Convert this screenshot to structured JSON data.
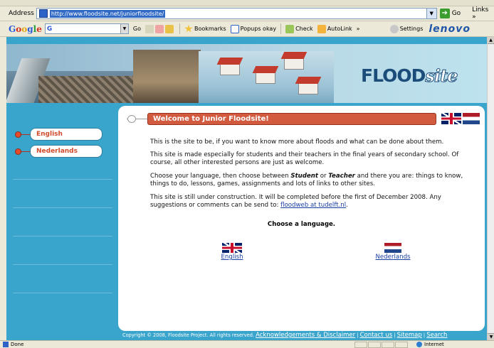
{
  "browser": {
    "address_label": "Address",
    "url": "http://www.floodsite.net/juniorfloodsite/",
    "go_label": "Go",
    "links_label": "Links »"
  },
  "google_toolbar": {
    "logo": "Google",
    "search_prefix": "G",
    "go_label": "Go",
    "bookmarks_label": "Bookmarks",
    "popups_label": "Popups okay",
    "check_label": "Check",
    "autolink_label": "AutoLink",
    "more_label": "»",
    "settings_label": "Settings",
    "brand": "lenovo"
  },
  "site": {
    "logo_main": "FLOOD",
    "logo_sub": "site",
    "sidebar": {
      "items": [
        {
          "label": "English"
        },
        {
          "label": "Nederlands"
        }
      ]
    },
    "welcome_title": "Welcome to Junior Floodsite!",
    "paragraphs": {
      "p1": "This is the site to be, if you want to know more about floods and what can be done about them.",
      "p2": "This site is made especially for students and their teachers in the final years of secondary school. Of course, all other interested persons are just as welcome.",
      "p3_a": "Choose your language, then choose between ",
      "p3_student": "Student",
      "p3_or": " or ",
      "p3_teacher": "Teacher",
      "p3_b": " and there you are: things to know, things to do, lessons, games, assignments and lots of links to other sites.",
      "p4_a": "This site is still under construction. It will be completed before the first of December 2008. Any suggestions or comments can be send to: ",
      "p4_link": "floodweb at tudelft.nl",
      "p4_end": "."
    },
    "choose_language": "Choose a language.",
    "languages": {
      "english": "English",
      "nederlands": "Nederlands"
    },
    "footer": {
      "copyright": "Copyright © 2008, Floodsite Project. All rights reserved.",
      "ack_link": "Acknowledgements & Disclaimer",
      "sep": " | ",
      "contact_link": "Contact us",
      "sitemap_link": "Sitemap",
      "search_link": "Search"
    }
  },
  "status_bar": {
    "status": "Done",
    "zone": "Internet"
  },
  "colors": {
    "page_bg": "#3aa5cc",
    "welcome_bar": "#d15a3f",
    "sidebar_text": "#d04a2b",
    "link": "#1a3fa4"
  }
}
